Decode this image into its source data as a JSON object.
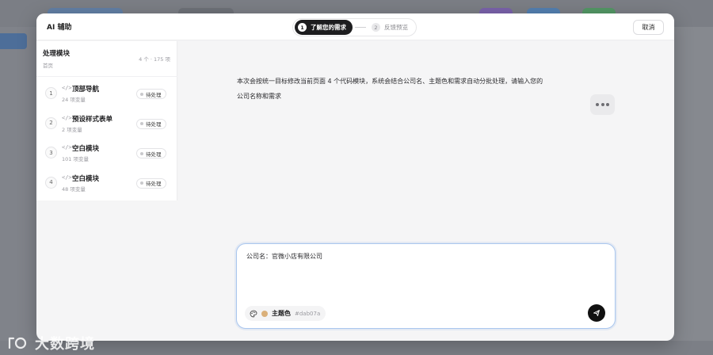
{
  "dialog": {
    "title": "AI 辅助",
    "steps": [
      {
        "num": "1",
        "label": "了解您的需求",
        "active": true
      },
      {
        "num": "2",
        "label": "反馈预览",
        "active": false
      }
    ],
    "cancel_label": "取消"
  },
  "left_panel": {
    "title": "处理模块",
    "subtitle": "首页",
    "count": "4 个 · 175 项",
    "modules": [
      {
        "index": "1",
        "code_icon": "</>",
        "name": "顶部导航",
        "vars": "24 项变量",
        "status": "待处理"
      },
      {
        "index": "2",
        "code_icon": "</>",
        "name": "预设样式表单",
        "vars": "2 项变量",
        "status": "待处理"
      },
      {
        "index": "3",
        "code_icon": "</>",
        "name": "空白模块",
        "vars": "101 项变量",
        "status": "待处理"
      },
      {
        "index": "4",
        "code_icon": "</>",
        "name": "空白模块",
        "vars": "48 项变量",
        "status": "待处理"
      }
    ]
  },
  "main": {
    "intro_line1": "本次会按统一目标修改当前页面 4 个代码模块，系统会结合公司名、主题色和需求自动分批处理，请输入您的",
    "intro_line2": "公司名称和需求",
    "composer": {
      "text": "公司名：官微小店有限公司",
      "theme_label": "主题色",
      "theme_color": "#dab07a",
      "theme_hex": "#dab07a"
    }
  },
  "watermark": {
    "text": "大数跨境"
  },
  "colors": {
    "active_step_bg": "#1d1d1f",
    "composer_border": "#a9c6ee",
    "send_button": "#111111"
  }
}
